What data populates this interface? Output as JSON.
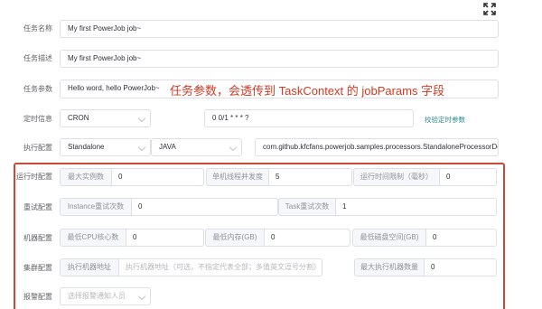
{
  "toolbar": {
    "expand_icon": "expand-icon"
  },
  "form": {
    "job_name": {
      "label": "任务名称",
      "value": "My first PowerJob job~"
    },
    "job_description": {
      "label": "任务描述",
      "value": "My first PowerJob job~"
    },
    "job_params": {
      "label": "任务参数",
      "value": "Hello word, hello PowerJob~"
    },
    "annotation": "任务参数，会透传到 TaskContext 的 jobParams 字段",
    "schedule": {
      "label": "定时信息",
      "type": "CRON",
      "expression": "0 0/1 * * * ?",
      "validate_link": "校验定时参数"
    },
    "execute": {
      "label": "执行配置",
      "mode": "Standalone",
      "processor_type": "JAVA",
      "processor_info": "com.github.kfcfans.powerjob.samples.processors.StandaloneProcessorDemo"
    },
    "runtime": {
      "label": "运行时配置",
      "max_instance_label": "最大实例数",
      "max_instance_value": "0",
      "concurrency_label": "单机线程并发度",
      "concurrency_value": "5",
      "time_limit_label": "运行时间限制（毫秒）",
      "time_limit_value": "0"
    },
    "retry": {
      "label": "重试配置",
      "instance_retry_label": "Instance重试次数",
      "instance_retry_value": "0",
      "task_retry_label": "Task重试次数",
      "task_retry_value": "1"
    },
    "machine": {
      "label": "机器配置",
      "min_cpu_label": "最低CPU核心数",
      "min_cpu_value": "0",
      "min_memory_label": "最低内存(GB)",
      "min_memory_value": "0",
      "min_disk_label": "最低磁盘空间(GB)",
      "min_disk_value": "0"
    },
    "cluster": {
      "label": "集群配置",
      "address_label": "执行机器地址",
      "address_placeholder": "执行机器地址（可选，不指定代表全部；多值英文逗号分割）",
      "max_workers_label": "最大执行机器数量",
      "max_workers_value": "0"
    },
    "alarm": {
      "label": "报警配置",
      "placeholder": "选择报警通知人员"
    }
  }
}
